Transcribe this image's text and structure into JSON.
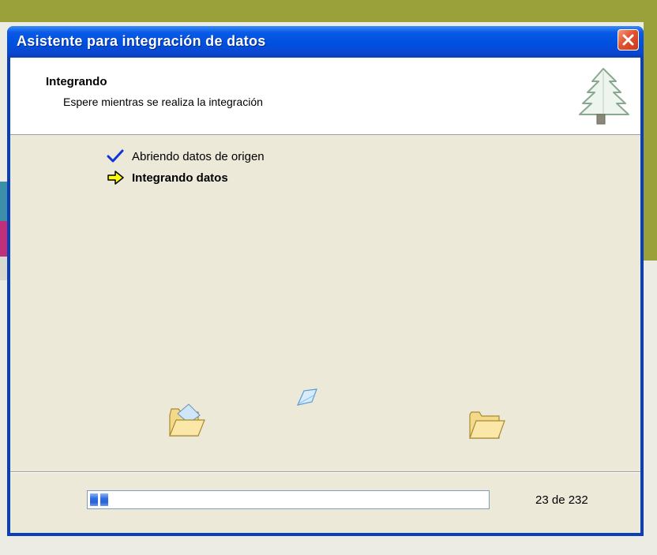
{
  "window": {
    "title": "Asistente para integración de datos"
  },
  "header": {
    "title": "Integrando",
    "subtitle": "Espere mientras se realiza la integración"
  },
  "steps": [
    {
      "label": "Abriendo datos de origen",
      "status": "done",
      "icon": "checkmark-icon"
    },
    {
      "label": "Integrando datos",
      "status": "current",
      "icon": "arrow-right-icon"
    }
  ],
  "progress": {
    "current": 23,
    "total": 232,
    "text": "23 de 232"
  },
  "colors": {
    "titlebar": "#0050e0",
    "progress": "#2f6de0",
    "check": "#1034d8",
    "arrow": "#ffff00"
  }
}
